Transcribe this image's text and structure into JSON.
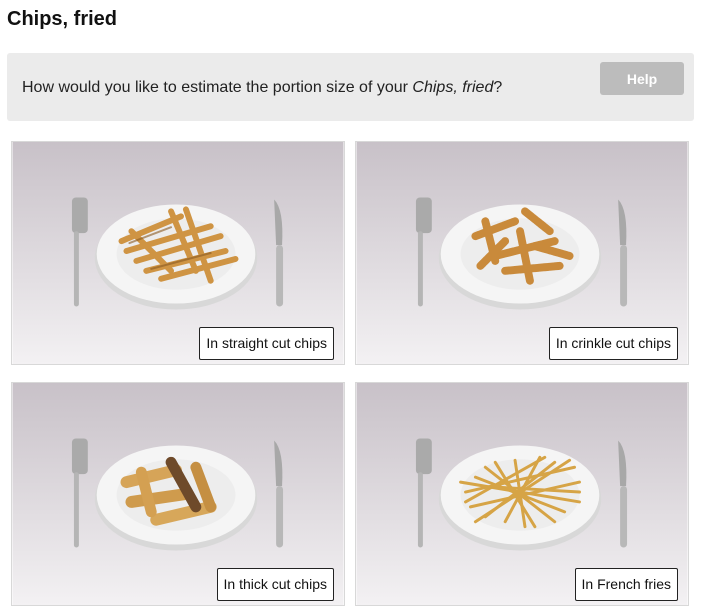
{
  "page": {
    "title": "Chips, fried"
  },
  "question": {
    "prefix": "How would you like to estimate the portion size of your ",
    "food": "Chips, fried",
    "suffix": "?",
    "help_label": "Help"
  },
  "options": [
    {
      "label": "In straight cut chips"
    },
    {
      "label": "In crinkle cut chips"
    },
    {
      "label": "In thick cut chips"
    },
    {
      "label": "In French fries"
    }
  ],
  "colors": {
    "panel_bg": "#ebebeb",
    "help_button_bg": "#bcbcbc",
    "photo_bg_top": "#c9c2c9",
    "photo_bg_bottom": "#f2f0f2",
    "plate": "#f4f4f4",
    "chip": "#d29a45",
    "chip_dark": "#8a5a22"
  }
}
